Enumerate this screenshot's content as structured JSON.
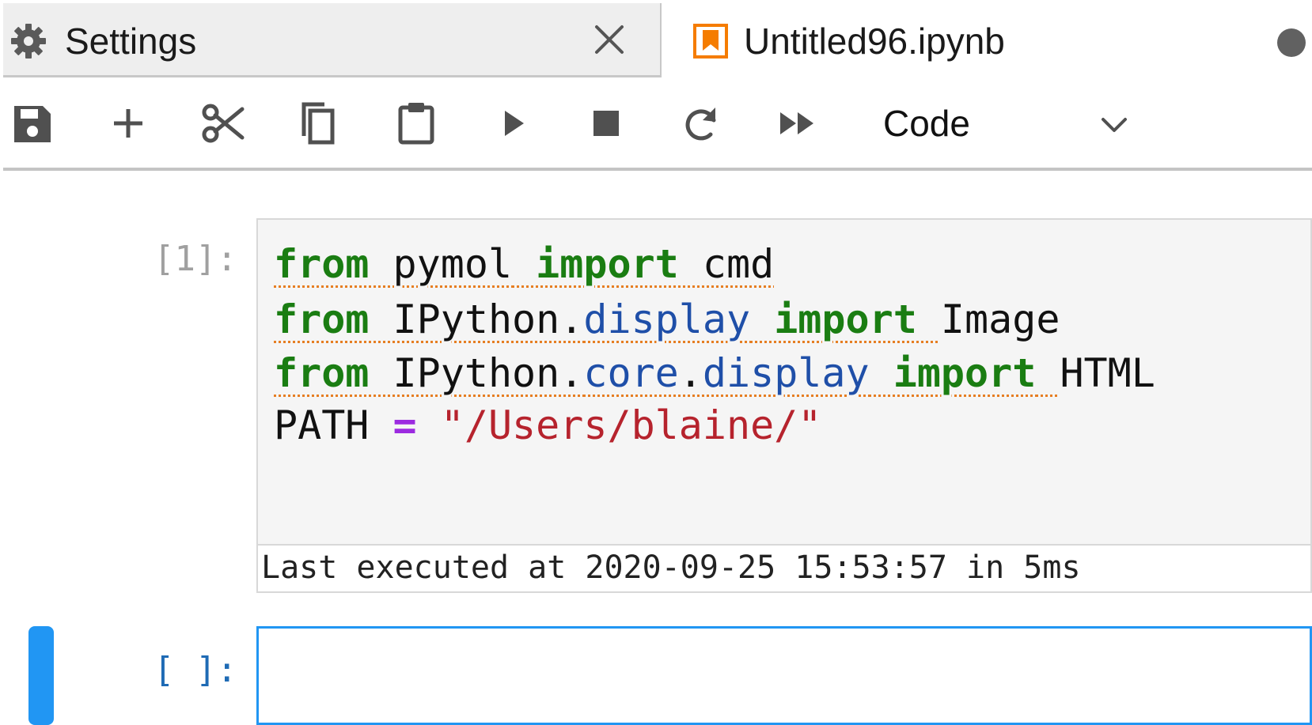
{
  "tabs": {
    "settings": {
      "label": "Settings",
      "icon": "gear-icon",
      "close_icon": "close-icon"
    },
    "notebook": {
      "label": "Untitled96.ipynb",
      "icon": "notebook-icon",
      "status_icon": "unsaved-dot-icon"
    }
  },
  "toolbar": {
    "buttons": [
      "save-icon",
      "add-cell-icon",
      "cut-icon",
      "copy-icon",
      "paste-icon",
      "run-icon",
      "stop-icon",
      "restart-icon",
      "run-all-icon"
    ],
    "cell_type": "Code"
  },
  "cells": [
    {
      "prompt": "[1]:",
      "code": {
        "line1": {
          "kw1": "from",
          "mod": "pymol",
          "kw2": "import",
          "name": "cmd"
        },
        "line2": {
          "kw1": "from",
          "mod": "IPython.",
          "sub": "display",
          "kw2": "import",
          "name": "Image"
        },
        "line3": {
          "kw1": "from",
          "mod": "IPython.",
          "sub1": "core",
          "dot": ".",
          "sub2": "display",
          "kw2": "import",
          "name": "HTML"
        },
        "line4": {
          "var": "PATH",
          "op": "=",
          "str": "\"/Users/blaine/\""
        }
      },
      "execution": "Last executed at 2020-09-25 15:53:57 in 5ms"
    },
    {
      "prompt": "[ ]:"
    }
  ],
  "colors": {
    "keyword": "#1a7d12",
    "attribute": "#1f4fa8",
    "operator": "#9c2be0",
    "string": "#b6232d",
    "active_cell": "#2196f3",
    "notebook_icon": "#f57c00"
  }
}
